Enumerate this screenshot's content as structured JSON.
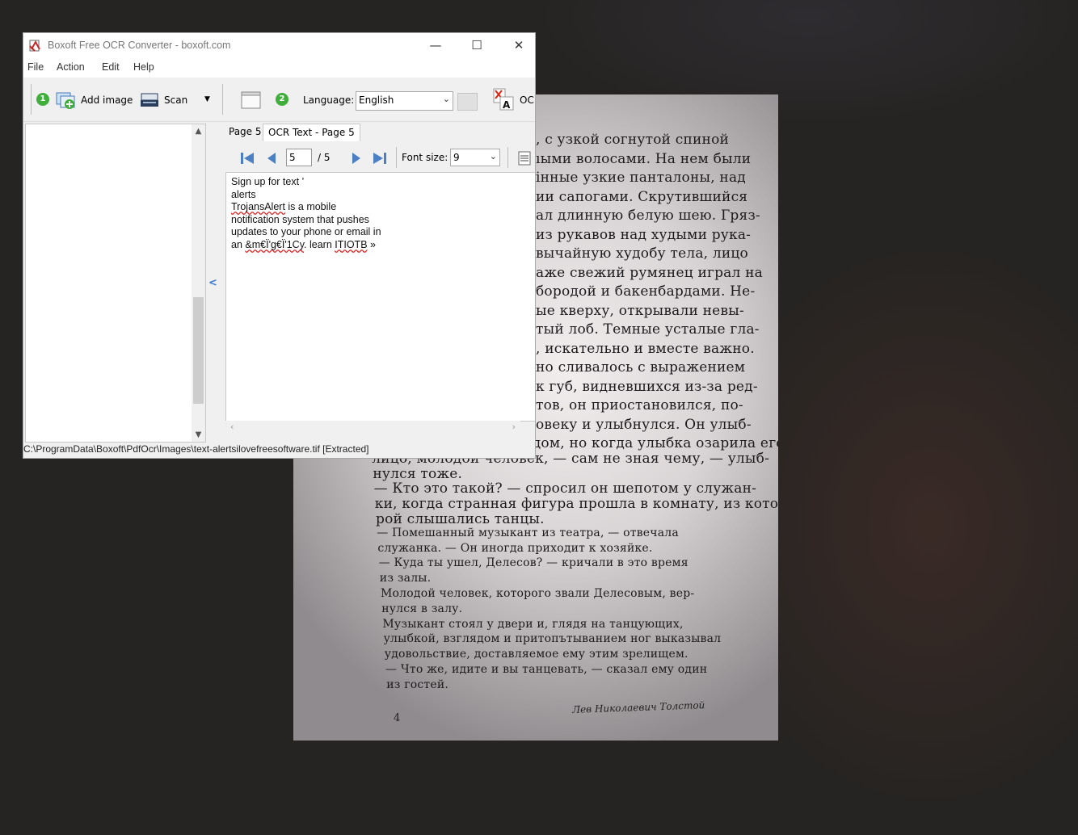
{
  "window": {
    "title": "Boxoft Free OCR Converter - boxoft.com",
    "minimize": "—",
    "maximize": "☐",
    "close": "✕"
  },
  "menu": [
    "File",
    "Action",
    "Edit",
    "Help"
  ],
  "toolbar": {
    "step1": "1",
    "add_image": "Add image",
    "scan": "Scan",
    "scan_dropdown": "▼",
    "step2": "2",
    "language_label": "Language:",
    "language_value": "English",
    "ocr_label": "OC"
  },
  "left_panel": {
    "scroll_up": "▲",
    "scroll_down": "▼",
    "collapse_arrow": "<"
  },
  "tabs": [
    "Page 5",
    "OCR Text - Page 5"
  ],
  "navigation": {
    "page_value": "5",
    "page_total": "/ 5",
    "font_size_label": "Font size:",
    "font_size_value": "9"
  },
  "ocr_text": [
    "Sign up for text ’",
    "alerts",
    "TrojansAlert is a mobile",
    "notification system that pushes",
    "updates to your phone or email in",
    "an &m€Ï'g€Ï'1Cy. learn ITIOTB »"
  ],
  "status_bar": "C:\\ProgramData\\Boxoft\\PdfOcr\\Images\\text-alertsilovefreesoftware.tif [Extracted]",
  "photo": {
    "lines": [
      ", с узкой согнутой спиной",
      "ıыми волосами. На нем были",
      "інные узкие панталоны, над",
      "ии сапогами. Скрутившийся",
      "ал длинную белую шею. Гряз-",
      "из рукавов над худыми рука-",
      "вычайную худобу тела, лицо",
      "аже свежий румянец играл на",
      "бородой и бакенбардами. Не-",
      "ые кверху, открывали невы-",
      "тый лоб. Темные усталые гла-",
      ", искательно и вместе важно.",
      "но сливалось с выражением",
      "к губ, видневшихся из-за ред-",
      "тов, он приостановился, по-",
      "овеку и улыбнулся. Он улыб-",
      "нулся как будто с трудом, но когда улыбка озарила его",
      "лицо, молодой человек, — сам не зная чему, — улыб-",
      "нулся тоже.",
      "— Кто это такой? — спросил он шепотом у служан-",
      "ки, когда странная фигура прошла в комнату, из кото-",
      "рой слышались танцы.",
      "— Помешанный музыкант из театра, — отвечала",
      "служанка. — Он иногда приходит к хозяйке.",
      "— Куда ты ушел, Делесов? — кричали в это время",
      "из залы.",
      "Молодой человек, которого звали Делесовым, вер-",
      "нулся в залу.",
      "Музыкант стоял у двери и, глядя на танцующих,",
      "улыбкой, взглядом и притопътыванием ног выказывал",
      "удовольствие, доставляемое ему этим зрелищем.",
      "— Что же, идите и вы танцевать, — сказал ему один",
      "из гостей."
    ],
    "page_number": "4",
    "signature": "Лев Николаевич Толстой"
  }
}
